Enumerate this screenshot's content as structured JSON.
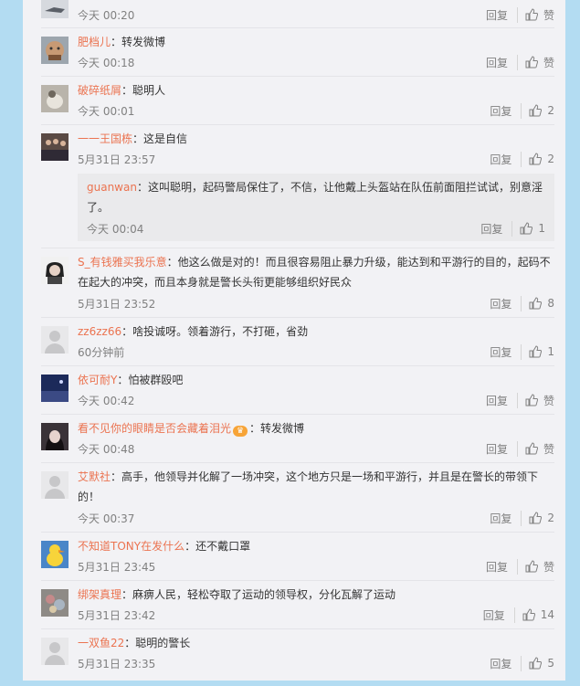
{
  "comments": [
    {
      "user": "",
      "text": "",
      "time": "今天 00:20",
      "reply": "回复",
      "like": "赞"
    },
    {
      "user": "肥档儿",
      "text": "转发微博",
      "time": "今天 00:18",
      "reply": "回复",
      "like": "赞"
    },
    {
      "user": "破碎纸屑",
      "text": "聪明人",
      "time": "今天 00:01",
      "reply": "回复",
      "like": "2"
    },
    {
      "user": "一一王国栋",
      "text": "这是自信",
      "time": "5月31日 23:57",
      "reply": "回复",
      "like": "2",
      "quote": {
        "user": "guanwan",
        "text": "这叫聪明，起码警局保住了，不信，让他戴上头盔站在队伍前面阻拦试试，别意淫了。",
        "time": "今天 00:04",
        "reply": "回复",
        "like": "1"
      }
    },
    {
      "user": "S_有钱雅买我乐意",
      "text": "他这么做是对的！而且很容易阻止暴力升级，能达到和平游行的目的，起码不在起大的冲突，而且本身就是警长头衔更能够组织好民众",
      "time": "5月31日 23:52",
      "reply": "回复",
      "like": "8"
    },
    {
      "user": "zz6zz66",
      "text": "啥投诚呀。领着游行，不打砸，省劲",
      "time": "60分钟前",
      "reply": "回复",
      "like": "1"
    },
    {
      "user": "依可耐Y",
      "text": "怕被群殴吧",
      "time": "今天 00:42",
      "reply": "回复",
      "like": "赞"
    },
    {
      "user": "看不见你的眼睛是否会藏着泪光",
      "text": "转发微博",
      "time": "今天 00:48",
      "reply": "回复",
      "like": "赞"
    },
    {
      "user": "艾默社",
      "text": "高手，他领导并化解了一场冲突，这个地方只是一场和平游行，并且是在警长的带领下的！",
      "time": "今天 00:37",
      "reply": "回复",
      "like": "2"
    },
    {
      "user": "不知道TONY在发什么",
      "text": "还不戴口罩",
      "time": "5月31日 23:45",
      "reply": "回复",
      "like": "赞"
    },
    {
      "user": "绑架真理",
      "text": "麻痹人民，轻松夺取了运动的领导权，分化瓦解了运动",
      "time": "5月31日 23:42",
      "reply": "回复",
      "like": "14"
    },
    {
      "user": "一双鱼22",
      "text": "聪明的警长",
      "time": "5月31日 23:35",
      "reply": "回复",
      "like": "5"
    }
  ],
  "colors": {
    "user": "#eb7350",
    "background": "#b3dcf2",
    "panel": "#f2f2f5"
  }
}
